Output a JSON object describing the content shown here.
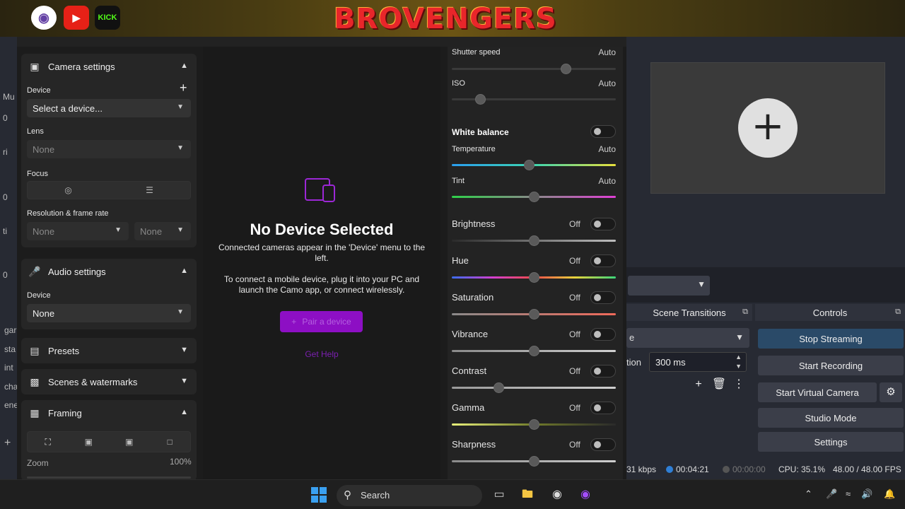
{
  "banner": {
    "title": "BROVENGERS",
    "socials": [
      "twitch-icon",
      "youtube-icon",
      "KICK"
    ]
  },
  "camo": {
    "camera_settings": {
      "title": "Camera settings",
      "device_label": "Device",
      "device_value": "Select a device...",
      "lens_label": "Lens",
      "lens_value": "None",
      "focus_label": "Focus",
      "resolution_label": "Resolution & frame rate",
      "resolution_value": "None",
      "framerate_value": "None"
    },
    "audio_settings": {
      "title": "Audio settings",
      "device_label": "Device",
      "device_value": "None"
    },
    "presets": {
      "title": "Presets"
    },
    "scenes": {
      "title": "Scenes & watermarks"
    },
    "framing": {
      "title": "Framing",
      "zoom_label": "Zoom",
      "zoom_value": "100%",
      "zoom_level": 1.0
    },
    "center": {
      "title": "No Device Selected",
      "text1": "Connected cameras appear in the 'Device' menu to the left.",
      "text2": "To connect a mobile device, plug it into your PC and launch the Camo app, or connect wirelessly.",
      "pair_button": "Pair a device",
      "help_link": "Get Help"
    },
    "image": {
      "shutter_label": "Shutter speed",
      "shutter_value": "Auto",
      "shutter_pos": 0.71,
      "iso_label": "ISO",
      "iso_value": "Auto",
      "iso_pos": 0.15,
      "wb_label": "White balance",
      "temp_label": "Temperature",
      "temp_value": "Auto",
      "temp_pos": 0.47,
      "tint_label": "Tint",
      "tint_value": "Auto",
      "tint_pos": 0.5,
      "adjustments": [
        {
          "label": "Brightness",
          "state": "Off",
          "pos": 0.5
        },
        {
          "label": "Hue",
          "state": "Off",
          "pos": 0.5
        },
        {
          "label": "Saturation",
          "state": "Off",
          "pos": 0.5
        },
        {
          "label": "Vibrance",
          "state": "Off",
          "pos": 0.5
        },
        {
          "label": "Contrast",
          "state": "Off",
          "pos": 0.27
        },
        {
          "label": "Gamma",
          "state": "Off",
          "pos": 0.5
        },
        {
          "label": "Sharpness",
          "state": "Off",
          "pos": 0.5
        }
      ]
    }
  },
  "obs": {
    "left_labels": [
      "Mu",
      "0",
      "ri",
      "0",
      "ti",
      "0",
      "gar",
      "sta",
      "int",
      "cha",
      "ene"
    ],
    "scene_transitions": "Scene Transitions",
    "transition_value": "e",
    "duration_label": "tion",
    "duration_value": "300 ms",
    "controls_title": "Controls",
    "controls": [
      "Stop Streaming",
      "Start Recording",
      "Start Virtual Camera",
      "Studio Mode",
      "Settings"
    ],
    "status": {
      "kbps": "31 kbps",
      "stream_time": "00:04:21",
      "rec_time": "00:00:00",
      "cpu": "CPU: 35.1%",
      "fps": "48.00 / 48.00 FPS"
    }
  },
  "taskbar": {
    "search_placeholder": "Search"
  }
}
